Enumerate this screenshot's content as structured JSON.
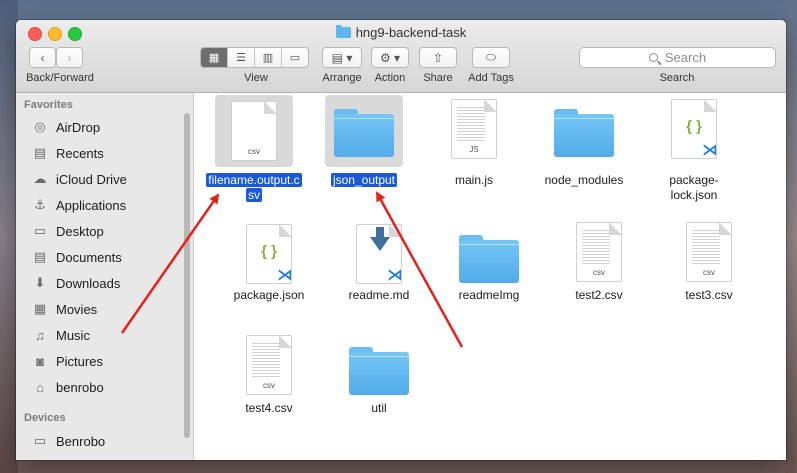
{
  "window": {
    "title": "hng9-backend-task"
  },
  "toolbar": {
    "back_forward_label": "Back/Forward",
    "view_label": "View",
    "arrange_label": "Arrange",
    "action_label": "Action",
    "share_label": "Share",
    "add_tags_label": "Add Tags",
    "search_label": "Search",
    "search_placeholder": "Search"
  },
  "sidebar": {
    "favorites_heading": "Favorites",
    "devices_heading": "Devices",
    "items": [
      {
        "label": "AirDrop",
        "icon": "airdrop-icon"
      },
      {
        "label": "Recents",
        "icon": "recents-icon"
      },
      {
        "label": "iCloud Drive",
        "icon": "icloud-icon"
      },
      {
        "label": "Applications",
        "icon": "applications-icon"
      },
      {
        "label": "Desktop",
        "icon": "desktop-icon"
      },
      {
        "label": "Documents",
        "icon": "documents-icon"
      },
      {
        "label": "Downloads",
        "icon": "downloads-icon"
      },
      {
        "label": "Movies",
        "icon": "movies-icon"
      },
      {
        "label": "Music",
        "icon": "music-icon"
      },
      {
        "label": "Pictures",
        "icon": "pictures-icon"
      },
      {
        "label": "benrobo",
        "icon": "home-icon"
      }
    ],
    "devices": [
      {
        "label": "Benrobo",
        "icon": "laptop-icon"
      }
    ]
  },
  "files": [
    {
      "name": "filename.output.csv",
      "line1": "filename.output.c",
      "line2": "sv",
      "kind": "csv",
      "selected": true
    },
    {
      "name": "json_output",
      "line1": "json_output",
      "line2": "",
      "kind": "folder",
      "selected": true
    },
    {
      "name": "main.js",
      "line1": "main.js",
      "line2": "",
      "kind": "js",
      "tag": "JS"
    },
    {
      "name": "node_modules",
      "line1": "node_modules",
      "line2": "",
      "kind": "folder"
    },
    {
      "name": "package-lock.json",
      "line1": "package-",
      "line2": "lock.json",
      "kind": "json"
    },
    {
      "name": "package.json",
      "line1": "package.json",
      "line2": "",
      "kind": "json"
    },
    {
      "name": "readme.md",
      "line1": "readme.md",
      "line2": "",
      "kind": "md"
    },
    {
      "name": "readmeImg",
      "line1": "readmeImg",
      "line2": "",
      "kind": "folder"
    },
    {
      "name": "test2.csv",
      "line1": "test2.csv",
      "line2": "",
      "kind": "csv"
    },
    {
      "name": "test3.csv",
      "line1": "test3.csv",
      "line2": "",
      "kind": "csv"
    },
    {
      "name": "test4.csv",
      "line1": "test4.csv",
      "line2": "",
      "kind": "csv"
    },
    {
      "name": "util",
      "line1": "util",
      "line2": "",
      "kind": "folder"
    }
  ],
  "doc_tags": {
    "csv": "csv",
    "js": "JS",
    "braces": "{ }",
    "vscode": "⋊"
  },
  "colors": {
    "selection": "#1b5ad6",
    "arrow": "#e8201a",
    "folder": "#5db6ef"
  }
}
